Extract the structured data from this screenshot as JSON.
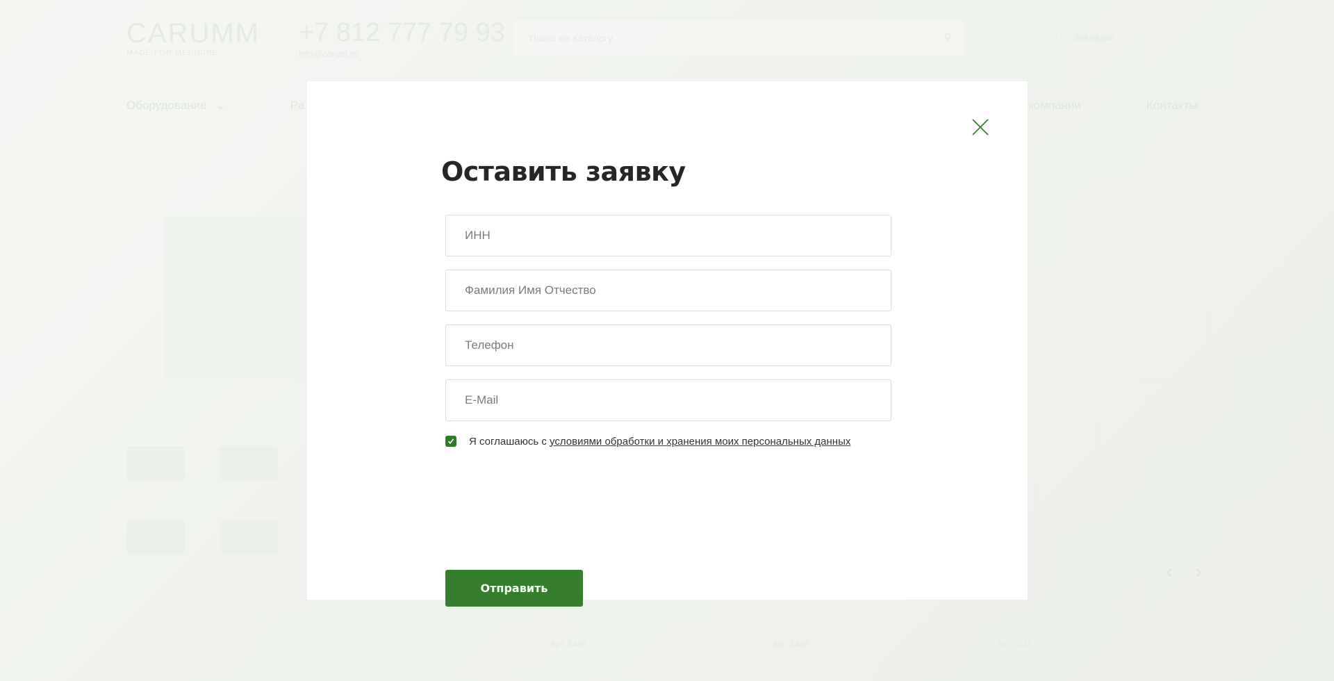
{
  "background": {
    "logo": {
      "name": "CARUMM",
      "tagline": "MADE FOR MEDICINE"
    },
    "contacts": {
      "phone": "+7 812 777 79 93",
      "email": "info@corum.ru"
    },
    "search": {
      "placeholder": "Поиск по Каталогу"
    },
    "bookmarks": {
      "label": "Закладки"
    },
    "nav": {
      "equipment": "Оборудование",
      "item2": "Ра",
      "about": "компании",
      "contacts": "Контакты"
    },
    "articles": [
      "Арт. 5445",
      "Арт. 5445",
      "Арт. 5445"
    ]
  },
  "modal": {
    "title": "Оставить заявку",
    "fields": {
      "inn": "ИНН",
      "fullname": "Фамилия Имя Отчество",
      "phone": "Телефон",
      "email": "E-Mail"
    },
    "consent": {
      "checked": true,
      "text": "Я соглашаюсь с ",
      "link": "условиями обработки и хранения моих персональных данных"
    },
    "submit_label": "Отправить"
  },
  "colors": {
    "accent": "#357e2e",
    "title": "#262626",
    "placeholder": "#7b7b7b"
  },
  "icons": {
    "close": "close-icon",
    "checkbox": "checkmark-icon",
    "search": "search-icon",
    "bookmark": "heart-icon"
  }
}
